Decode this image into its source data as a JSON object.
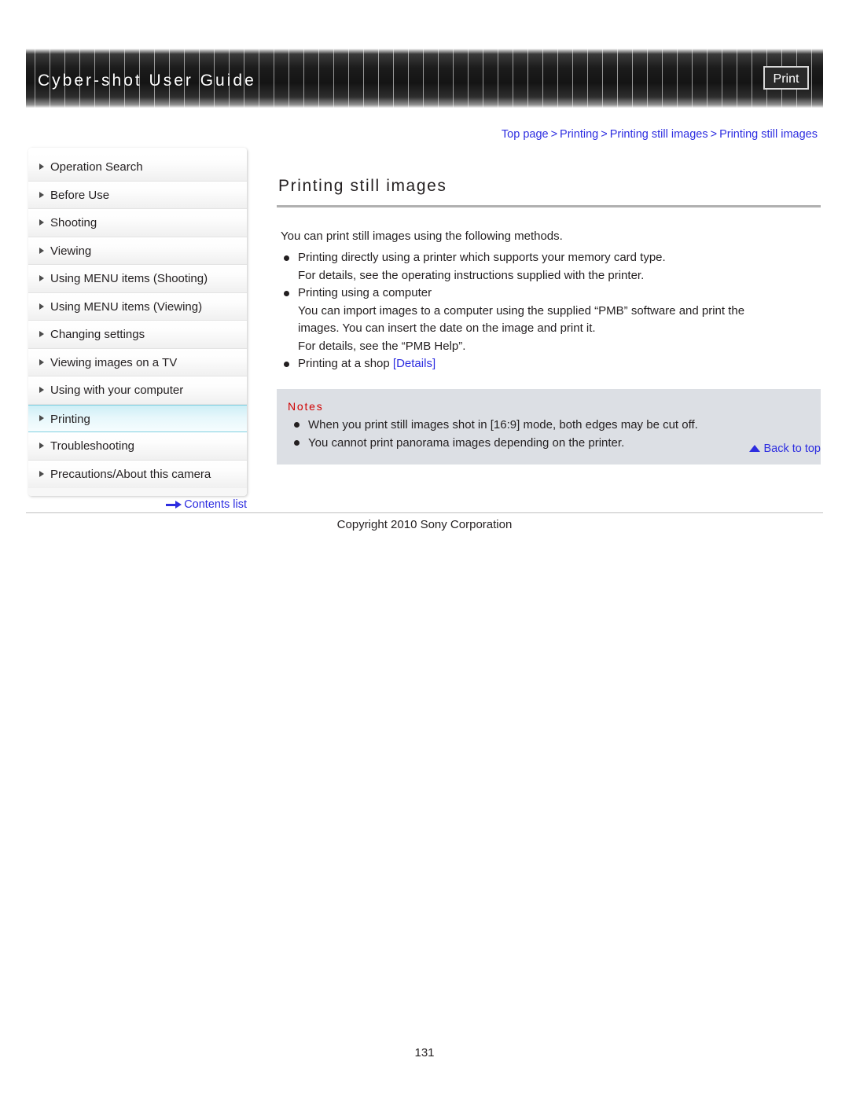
{
  "header": {
    "title": "Cyber-shot User Guide",
    "print_label": "Print"
  },
  "breadcrumb": {
    "separator": ">",
    "items": [
      "Top page",
      "Printing",
      "Printing still images",
      "Printing still images"
    ]
  },
  "sidebar": {
    "items": [
      {
        "label": "Operation Search",
        "active": false
      },
      {
        "label": "Before Use",
        "active": false
      },
      {
        "label": "Shooting",
        "active": false
      },
      {
        "label": "Viewing",
        "active": false
      },
      {
        "label": "Using MENU items (Shooting)",
        "active": false
      },
      {
        "label": "Using MENU items (Viewing)",
        "active": false
      },
      {
        "label": "Changing settings",
        "active": false
      },
      {
        "label": "Viewing images on a TV",
        "active": false
      },
      {
        "label": "Using with your computer",
        "active": false
      },
      {
        "label": "Printing",
        "active": true
      },
      {
        "label": "Troubleshooting",
        "active": false
      },
      {
        "label": "Precautions/About this camera",
        "active": false
      }
    ],
    "contents_list_label": "Contents list"
  },
  "main": {
    "title": "Printing still images",
    "intro": "You can print still images using the following methods.",
    "methods": [
      {
        "text": "Printing directly using a printer which supports your memory card type.",
        "sublines": [
          "For details, see the operating instructions supplied with the printer."
        ]
      },
      {
        "text": "Printing using a computer",
        "sublines": [
          "You can import images to a computer using the supplied “PMB” software and print the",
          "images. You can insert the date on the image and print it.",
          "For details, see the “PMB Help”."
        ]
      },
      {
        "text": "Printing at a shop ",
        "link": "[Details]",
        "sublines": []
      }
    ],
    "notes": {
      "title": "Notes",
      "items": [
        "When you print still images shot in [16:9] mode, both edges may be cut off.",
        "You cannot print panorama images depending on the printer."
      ]
    },
    "back_to_top_label": "Back to top"
  },
  "footer": {
    "copyright": "Copyright 2010 Sony Corporation",
    "page_number": "131"
  },
  "colors": {
    "link": "#2d2de0",
    "notes_title": "#d00000",
    "notes_bg": "#dcdfe4",
    "active_nav": "#cdeef6"
  }
}
